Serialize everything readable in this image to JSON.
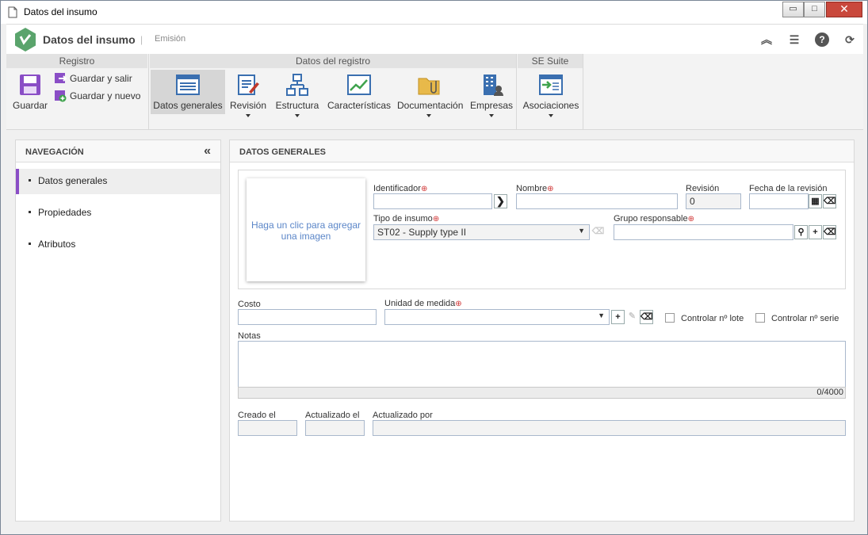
{
  "window": {
    "title": "Datos del insumo",
    "min": "▭",
    "max": "□",
    "close": "✕"
  },
  "header": {
    "title": "Datos del insumo",
    "separator": "|",
    "subtitle": "Emisión"
  },
  "ribbon": {
    "registro": {
      "label": "Registro",
      "save": "Guardar",
      "save_exit": "Guardar y salir",
      "save_new": "Guardar y nuevo"
    },
    "datos": {
      "label": "Datos del registro",
      "items": [
        "Datos generales",
        "Revisión",
        "Estructura",
        "Características",
        "Documentación",
        "Empresas"
      ]
    },
    "suite": {
      "label": "SE Suite",
      "items": [
        "Asociaciones"
      ]
    }
  },
  "nav": {
    "title": "NAVEGACIÓN",
    "collapse": "«",
    "items": [
      "Datos generales",
      "Propiedades",
      "Atributos"
    ]
  },
  "main": {
    "title": "DATOS GENERALES"
  },
  "form": {
    "image_hint": "Haga un clic para agregar una imagen",
    "identificador": {
      "label": "Identificador",
      "value": ""
    },
    "nombre": {
      "label": "Nombre",
      "value": ""
    },
    "revision": {
      "label": "Revisión",
      "value": "0"
    },
    "fecha_revision": {
      "label": "Fecha de la revisión",
      "value": ""
    },
    "tipo_insumo": {
      "label": "Tipo de insumo",
      "value": "ST02 - Supply type II"
    },
    "grupo_responsable": {
      "label": "Grupo responsable",
      "value": ""
    },
    "costo": {
      "label": "Costo",
      "value": ""
    },
    "unidad_medida": {
      "label": "Unidad de medida",
      "value": ""
    },
    "controlar_lote": {
      "label": "Controlar nº lote",
      "checked": false
    },
    "controlar_serie": {
      "label": "Controlar nº serie",
      "checked": false
    },
    "notas": {
      "label": "Notas",
      "counter": "0/4000"
    },
    "creado_el": {
      "label": "Creado el",
      "value": ""
    },
    "actualizado_el": {
      "label": "Actualizado el",
      "value": ""
    },
    "actualizado_por": {
      "label": "Actualizado por",
      "value": ""
    }
  },
  "colors": {
    "accent": "#8a4ec6",
    "logo": "#5aa46c",
    "required": "#d03535",
    "link": "#5b86c8"
  }
}
